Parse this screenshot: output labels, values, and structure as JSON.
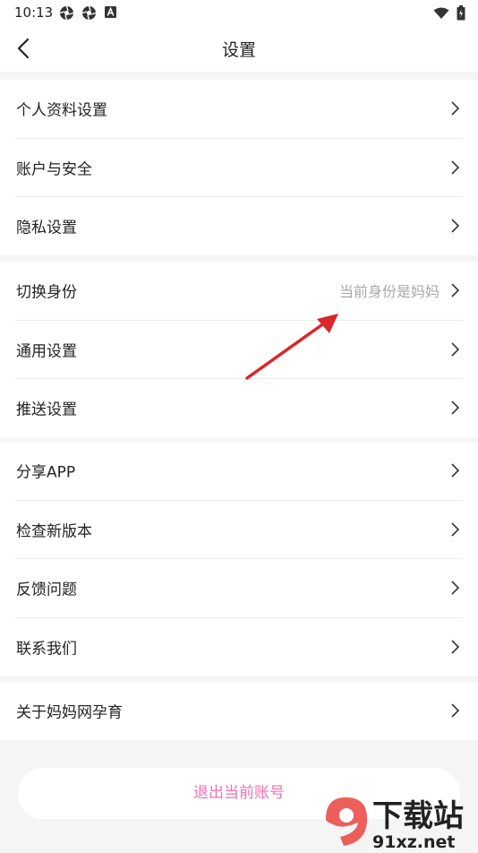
{
  "status_bar": {
    "time": "10:13",
    "icons": [
      "aperture-icon",
      "aperture-icon",
      "a-box-icon"
    ],
    "right_icons": [
      "wifi-icon",
      "battery-icon"
    ]
  },
  "header": {
    "title": "设置",
    "back_icon": "chevron-left-icon"
  },
  "groups": [
    {
      "items": [
        {
          "label": "个人资料设置"
        },
        {
          "label": "账户与安全"
        },
        {
          "label": "隐私设置"
        }
      ]
    },
    {
      "items": [
        {
          "label": "切换身份",
          "value": "当前身份是妈妈"
        },
        {
          "label": "通用设置"
        },
        {
          "label": "推送设置"
        }
      ]
    },
    {
      "items": [
        {
          "label": "分享APP"
        },
        {
          "label": "检查新版本"
        },
        {
          "label": "反馈问题"
        },
        {
          "label": "联系我们"
        }
      ]
    },
    {
      "items": [
        {
          "label": "关于妈妈网孕育"
        }
      ]
    }
  ],
  "logout_label": "退出当前账号",
  "colors": {
    "accent": "#f06fb3",
    "annotation_arrow": "#d9262b",
    "background": "#f5f5f5"
  },
  "watermark": {
    "big_text": "下载站",
    "small_text": "91xz.net"
  }
}
